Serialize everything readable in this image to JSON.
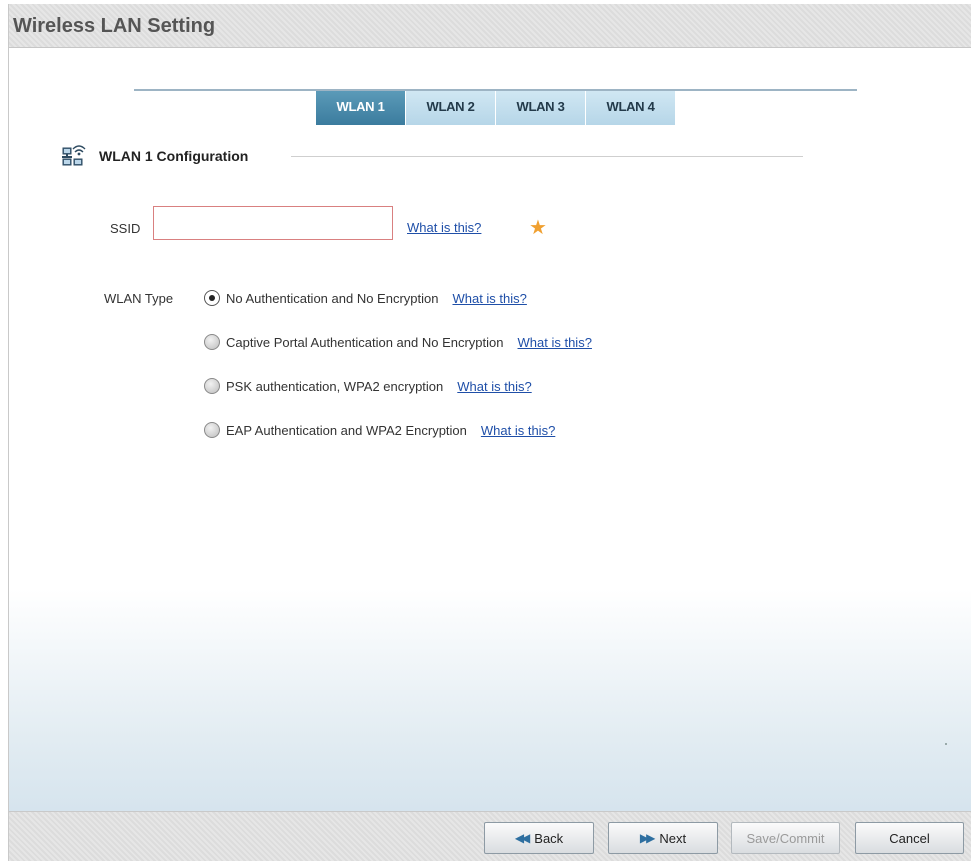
{
  "window": {
    "title": "Wireless LAN Setting"
  },
  "tabs": [
    {
      "label": "WLAN 1",
      "active": true
    },
    {
      "label": "WLAN 2",
      "active": false
    },
    {
      "label": "WLAN 3",
      "active": false
    },
    {
      "label": "WLAN 4",
      "active": false
    }
  ],
  "section": {
    "icon": "network-icon",
    "title": "WLAN 1 Configuration"
  },
  "ssid": {
    "label": "SSID",
    "value": "",
    "help_link": "What is this?",
    "required_marker": "★"
  },
  "wlan_type": {
    "label": "WLAN Type",
    "options": [
      {
        "label": "No Authentication and No Encryption",
        "selected": true,
        "help_link": "What is this?"
      },
      {
        "label": "Captive Portal Authentication and No Encryption",
        "selected": false,
        "help_link": "What is this?"
      },
      {
        "label": "PSK authentication, WPA2 encryption",
        "selected": false,
        "help_link": "What is this?"
      },
      {
        "label": "EAP Authentication and WPA2 Encryption",
        "selected": false,
        "help_link": "What is this?"
      }
    ]
  },
  "footer": {
    "back_label": "Back",
    "next_label": "Next",
    "save_label": "Save/Commit",
    "cancel_label": "Cancel",
    "save_enabled": false
  },
  "colors": {
    "tab_active": "#3b7c9e",
    "tab_inactive": "#c4e0ef",
    "link": "#1f4fa8",
    "required_star": "#f0a030",
    "ssid_border": "#d98080"
  }
}
